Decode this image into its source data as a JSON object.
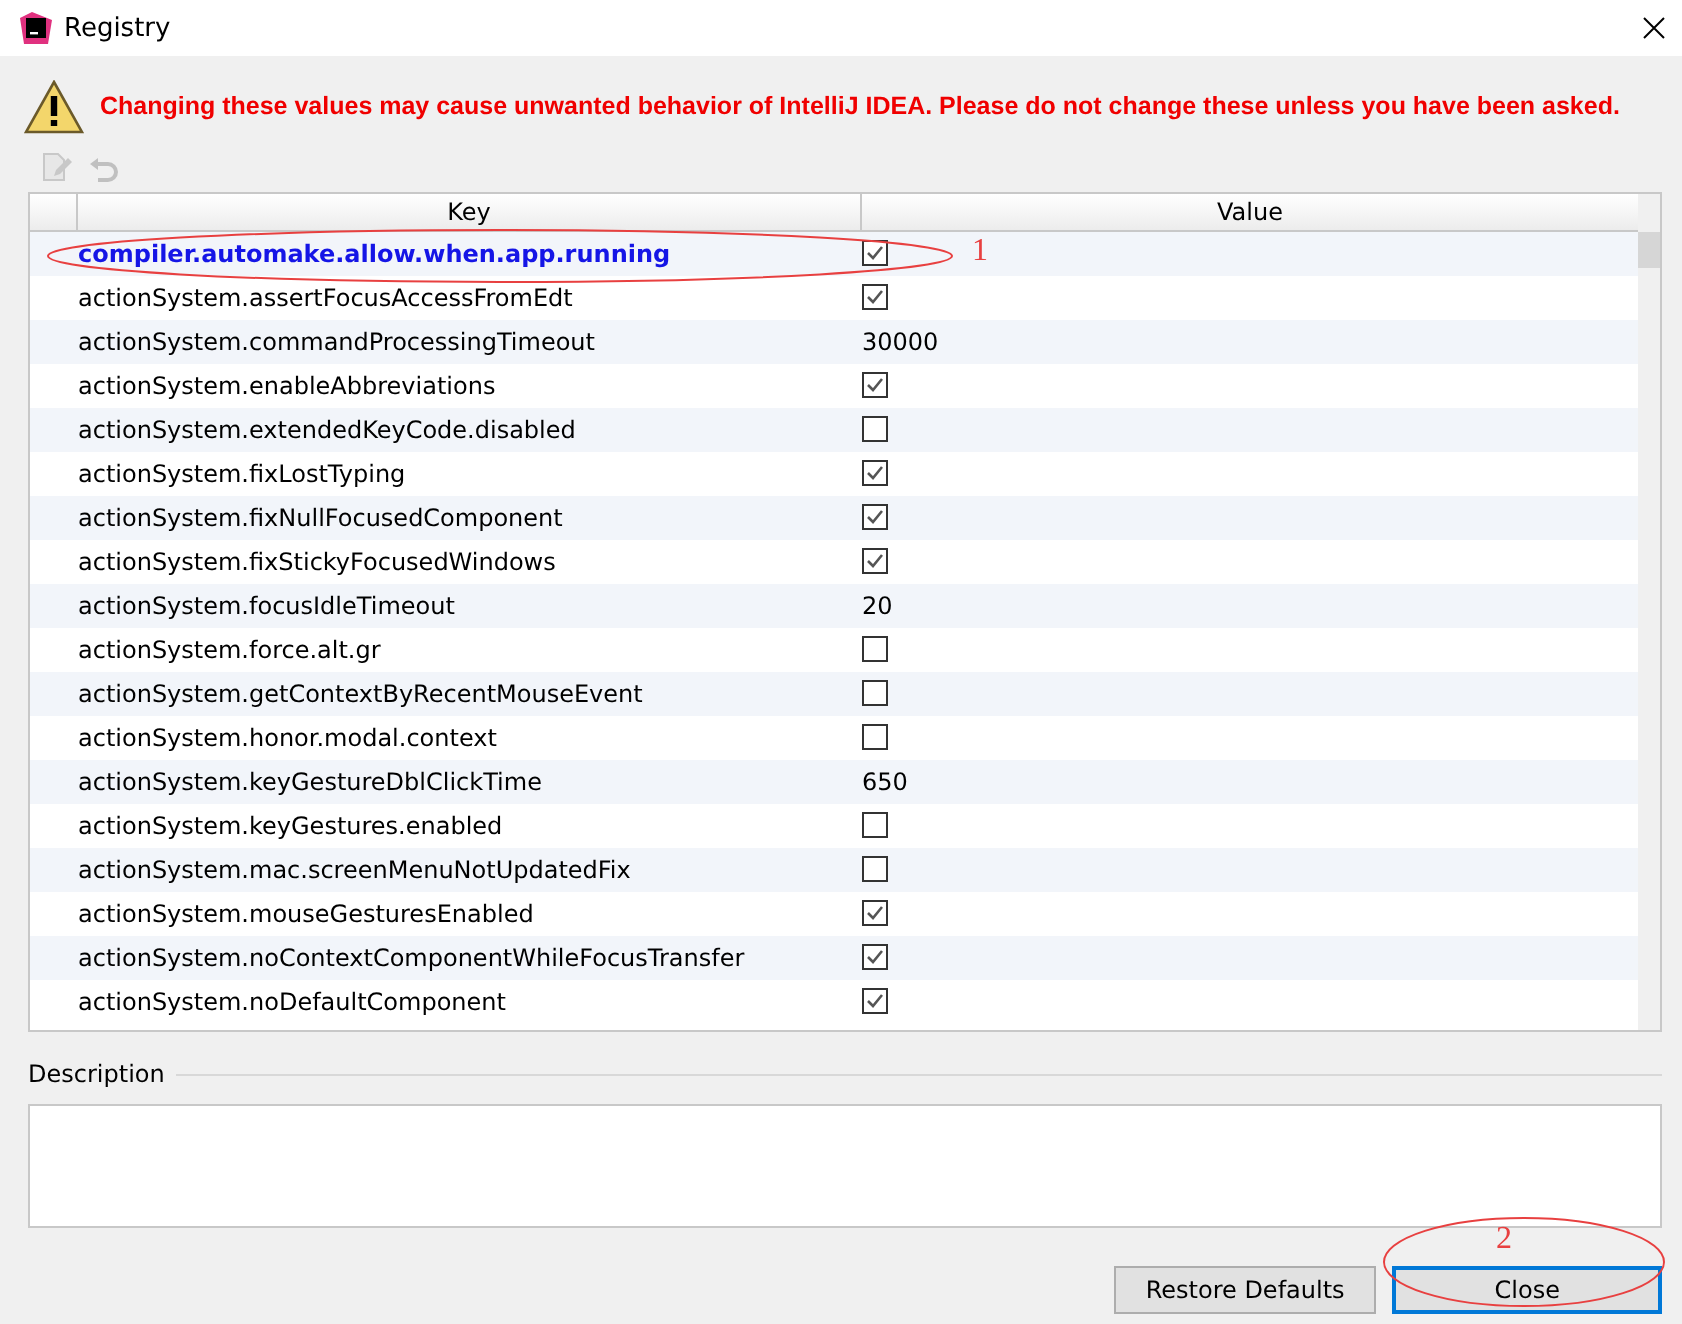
{
  "window": {
    "title": "Registry"
  },
  "warning": "Changing these values may cause unwanted behavior of IntelliJ IDEA. Please do not change these unless you have been asked.",
  "toolbar": [
    {
      "kind": "edit",
      "disabled": true
    },
    {
      "kind": "revert",
      "disabled": true
    }
  ],
  "table": {
    "columns": [
      "Key",
      "Value"
    ],
    "rows": [
      {
        "key": "compiler.automake.allow.when.app.running",
        "kind": "checkbox",
        "checked": true,
        "modified": true,
        "selected": false
      },
      {
        "key": "actionSystem.assertFocusAccessFromEdt",
        "kind": "checkbox",
        "checked": true,
        "modified": false,
        "selected": false
      },
      {
        "key": "actionSystem.commandProcessingTimeout",
        "kind": "text",
        "value": "30000",
        "modified": false,
        "selected": false
      },
      {
        "key": "actionSystem.enableAbbreviations",
        "kind": "checkbox",
        "checked": true,
        "modified": false,
        "selected": false
      },
      {
        "key": "actionSystem.extendedKeyCode.disabled",
        "kind": "checkbox",
        "checked": false,
        "modified": false,
        "selected": false
      },
      {
        "key": "actionSystem.fixLostTyping",
        "kind": "checkbox",
        "checked": true,
        "modified": false,
        "selected": false
      },
      {
        "key": "actionSystem.fixNullFocusedComponent",
        "kind": "checkbox",
        "checked": true,
        "modified": false,
        "selected": false
      },
      {
        "key": "actionSystem.fixStickyFocusedWindows",
        "kind": "checkbox",
        "checked": true,
        "modified": false,
        "selected": false
      },
      {
        "key": "actionSystem.focusIdleTimeout",
        "kind": "text",
        "value": "20",
        "modified": false,
        "selected": false
      },
      {
        "key": "actionSystem.force.alt.gr",
        "kind": "checkbox",
        "checked": false,
        "modified": false,
        "selected": false
      },
      {
        "key": "actionSystem.getContextByRecentMouseEvent",
        "kind": "checkbox",
        "checked": false,
        "modified": false,
        "selected": false
      },
      {
        "key": "actionSystem.honor.modal.context",
        "kind": "checkbox",
        "checked": false,
        "modified": false,
        "selected": false
      },
      {
        "key": "actionSystem.keyGestureDblClickTime",
        "kind": "text",
        "value": "650",
        "modified": false,
        "selected": false
      },
      {
        "key": "actionSystem.keyGestures.enabled",
        "kind": "checkbox",
        "checked": false,
        "modified": false,
        "selected": false
      },
      {
        "key": "actionSystem.mac.screenMenuNotUpdatedFix",
        "kind": "checkbox",
        "checked": false,
        "modified": false,
        "selected": false
      },
      {
        "key": "actionSystem.mouseGesturesEnabled",
        "kind": "checkbox",
        "checked": true,
        "modified": false,
        "selected": false
      },
      {
        "key": "actionSystem.noContextComponentWhileFocusTransfer",
        "kind": "checkbox",
        "checked": true,
        "modified": false,
        "selected": false
      },
      {
        "key": "actionSystem.noDefaultComponent",
        "kind": "checkbox",
        "checked": true,
        "modified": false,
        "selected": false
      }
    ]
  },
  "description": {
    "label": "Description"
  },
  "buttons": [
    {
      "label": "Restore Defaults",
      "focused": false
    },
    {
      "label": "Close",
      "focused": true
    }
  ],
  "annotations": [
    {
      "label": "1"
    },
    {
      "label": "2"
    }
  ]
}
